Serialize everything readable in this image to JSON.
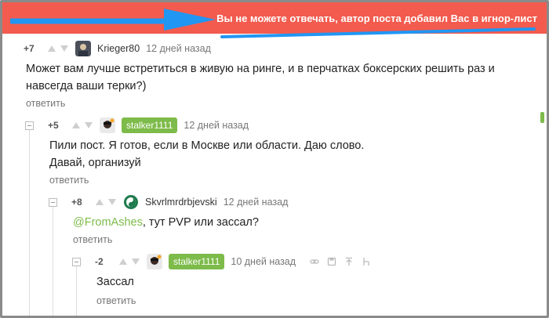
{
  "banner": {
    "text": "Вы не можете отвечать, автор поста добавил Вас в игнор-лист",
    "color": "#f25b4e"
  },
  "annotation": {
    "color": "#2196f3"
  },
  "accent": "#7dbb4a",
  "comments": [
    {
      "score": "+7",
      "author": "Krieger80",
      "time": "12 дней назад",
      "body_lines": [
        "Может вам лучше встретиться в живую на ринге, и в перчатках боксерских решить раз и",
        "навсегда ваши терки?)"
      ],
      "reply": "ответить"
    },
    {
      "score": "+5",
      "author": "stalker1111",
      "time": "12 дней назад",
      "body_lines": [
        "Пили пост. Я готов, если в Москве или области. Даю слово.",
        "Давай, организуй"
      ],
      "reply": "ответить"
    },
    {
      "score": "+8",
      "author": "Skvrlmrdrbjevski",
      "time": "12 дней назад",
      "mention": "@FromAshes",
      "body_rest": ", тут PVP или зассал?",
      "reply": "ответить"
    },
    {
      "score": "-2",
      "author": "stalker1111",
      "time": "10 дней назад",
      "body_lines": [
        "Зассал"
      ],
      "reply": "ответить"
    }
  ]
}
